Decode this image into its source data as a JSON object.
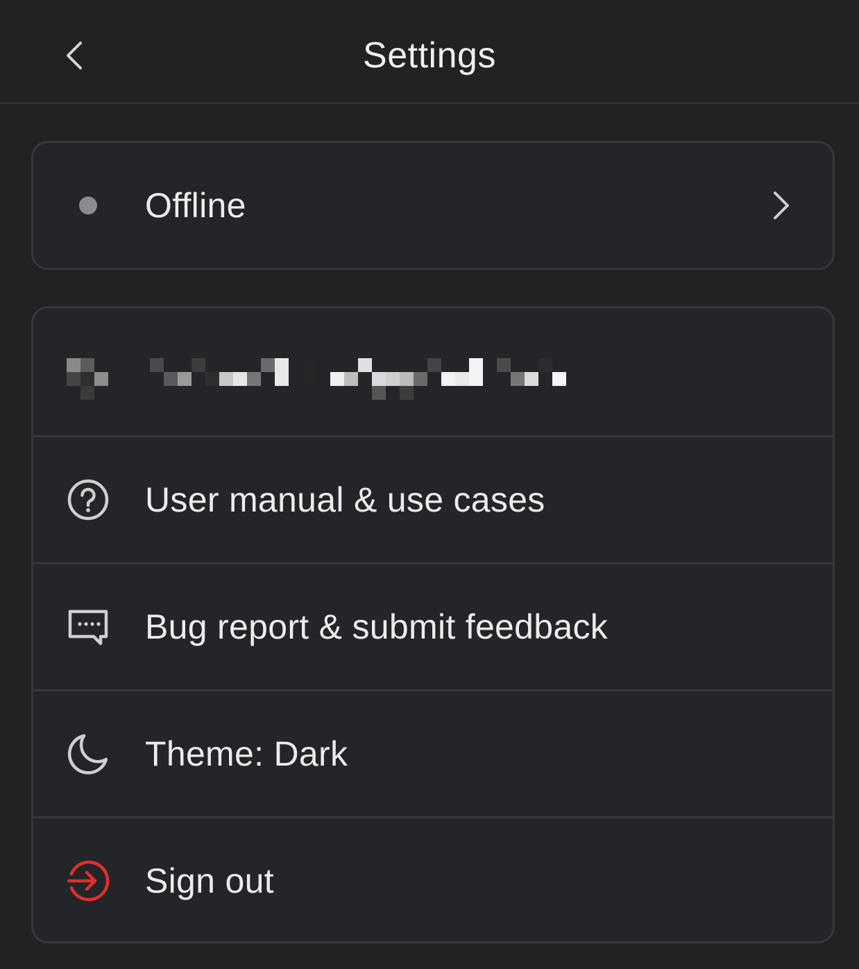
{
  "header": {
    "title": "Settings",
    "back_icon": "chevron-left-icon"
  },
  "status": {
    "label": "Offline",
    "dot_color": "#8a8b8d",
    "icon": "chevron-right-icon"
  },
  "menu": {
    "items": [
      {
        "label": "User manual & use cases",
        "icon": "help-circle-icon"
      },
      {
        "label": "Bug report & submit feedback",
        "icon": "message-dots-icon"
      },
      {
        "label": "Theme: Dark",
        "icon": "moon-icon"
      },
      {
        "label": "Sign out",
        "icon": "sign-out-icon",
        "color": "#e0302e"
      }
    ]
  },
  "colors": {
    "background": "#222222",
    "card": "#232528",
    "border": "#35373b",
    "text": "#ececec",
    "danger": "#e0302e"
  }
}
